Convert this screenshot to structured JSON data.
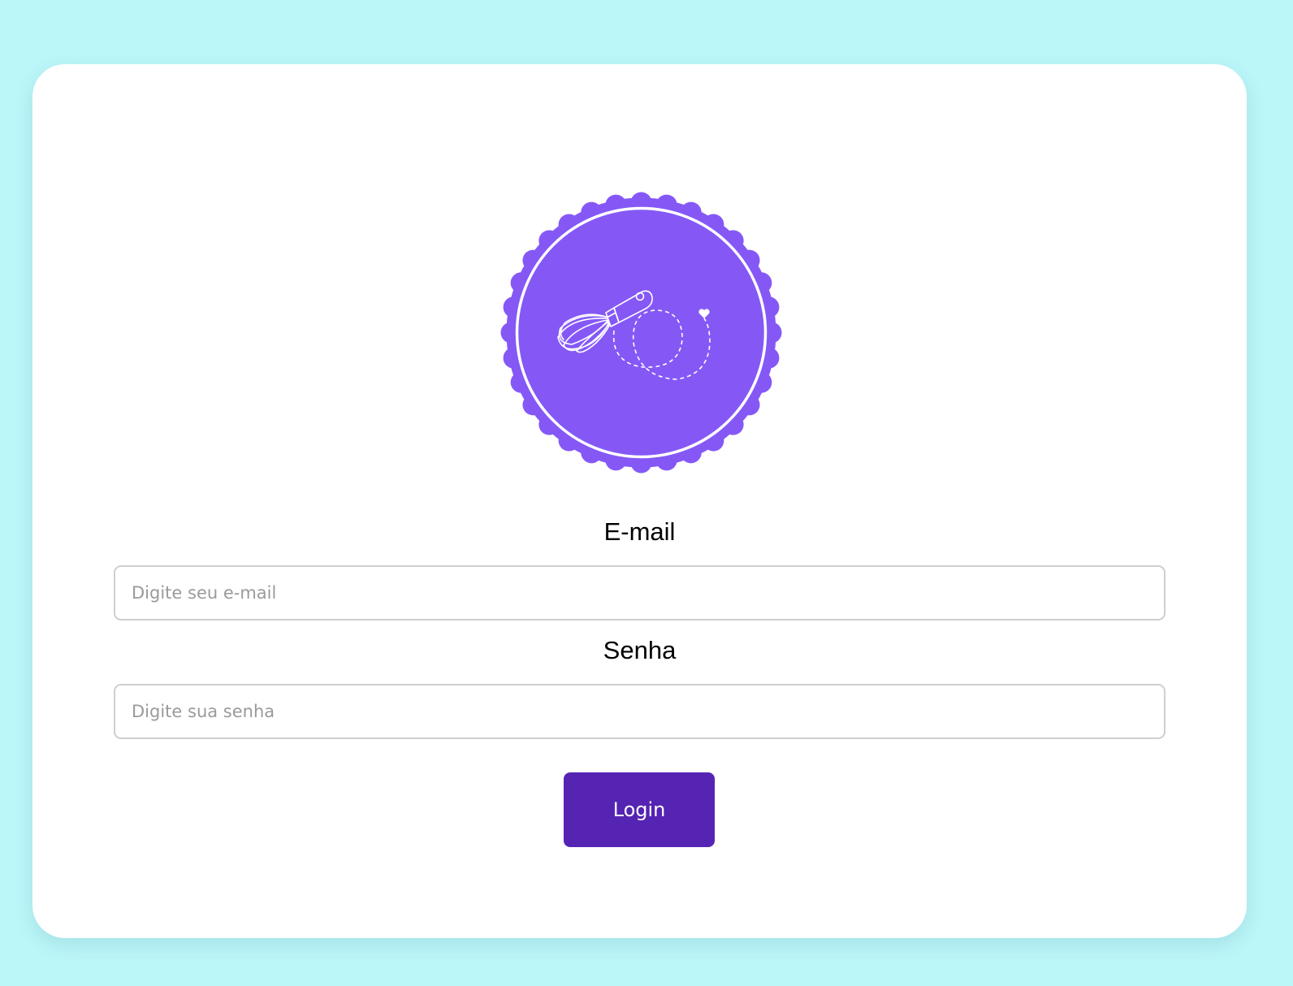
{
  "form": {
    "email_label": "E-mail",
    "email_placeholder": "Digite seu e-mail",
    "email_value": "",
    "password_label": "Senha",
    "password_placeholder": "Digite sua senha",
    "password_value": "",
    "login_label": "Login"
  },
  "logo": {
    "icon": "whisk-icon",
    "background_color": "#8558f6"
  },
  "colors": {
    "page_background": "#bbf6f9",
    "card_background": "#ffffff",
    "button": "#5524b3",
    "logo": "#8558f6"
  }
}
